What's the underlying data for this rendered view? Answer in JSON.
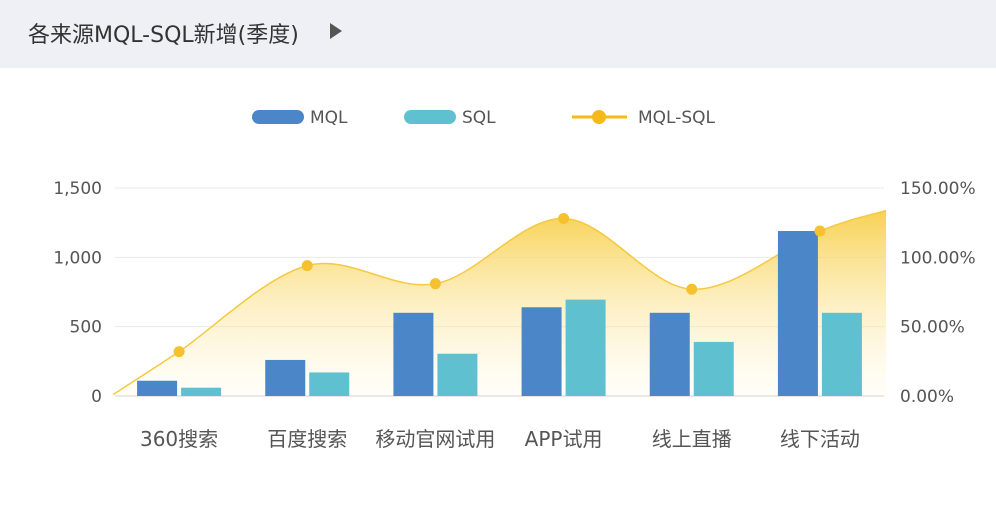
{
  "header": {
    "title": "各来源MQL-SQL新增(季度)"
  },
  "chart_data": {
    "type": "bar",
    "categories": [
      "360搜索",
      "百度搜索",
      "移动官网试用",
      "APP试用",
      "线上直播",
      "线下活动"
    ],
    "series": [
      {
        "name": "MQL",
        "type": "bar",
        "axis": "left",
        "color": "#4a86c8",
        "values": [
          110,
          260,
          600,
          640,
          600,
          1190
        ]
      },
      {
        "name": "SQL",
        "type": "bar",
        "axis": "left",
        "color": "#5fc1d0",
        "values": [
          60,
          170,
          305,
          695,
          390,
          600
        ]
      },
      {
        "name": "MQL-SQL",
        "type": "line-area",
        "axis": "right",
        "color": "#f5bd2c",
        "values": [
          32,
          94,
          81,
          128,
          77,
          119
        ]
      }
    ],
    "y_left": {
      "min": 0,
      "max": 1500,
      "ticks": [
        "0",
        "500",
        "1,000",
        "1,500"
      ]
    },
    "y_right": {
      "min": 0,
      "max": 150,
      "ticks": [
        "0.00%",
        "50.00%",
        "100.00%",
        "150.00%"
      ]
    },
    "legend_position": "top-center",
    "grid": true
  }
}
